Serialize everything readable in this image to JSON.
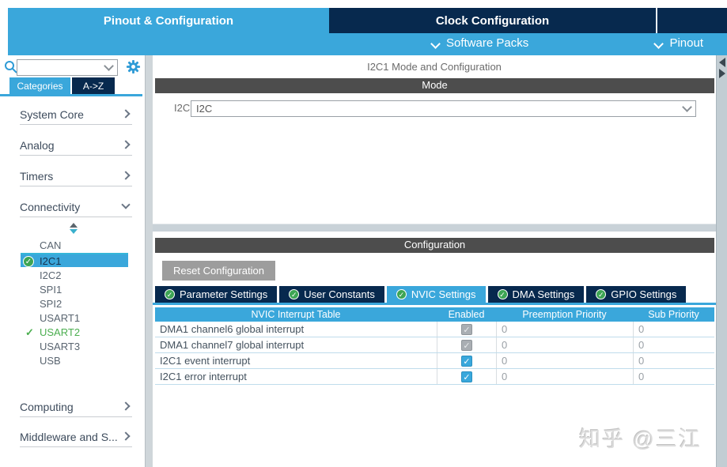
{
  "header": {
    "tabs": [
      {
        "label": "Pinout & Configuration",
        "active": true
      },
      {
        "label": "Clock Configuration",
        "active": false
      },
      {
        "label": "",
        "active": false
      }
    ],
    "subnav": [
      {
        "label": "Software Packs"
      },
      {
        "label": "Pinout"
      }
    ]
  },
  "sidebar": {
    "search": {
      "value": "",
      "placeholder": ""
    },
    "tabs": [
      {
        "label": "Categories",
        "active": true
      },
      {
        "label": "A->Z",
        "active": false
      }
    ],
    "categories": [
      {
        "label": "System Core",
        "state": "collapsed"
      },
      {
        "label": "Analog",
        "state": "collapsed"
      },
      {
        "label": "Timers",
        "state": "collapsed"
      },
      {
        "label": "Connectivity",
        "state": "expanded"
      }
    ],
    "connectivity_items": [
      {
        "label": "CAN",
        "selected": false,
        "configured": false
      },
      {
        "label": "I2C1",
        "selected": true,
        "configured": true
      },
      {
        "label": "I2C2",
        "selected": false,
        "configured": false
      },
      {
        "label": "SPI1",
        "selected": false,
        "configured": false
      },
      {
        "label": "SPI2",
        "selected": false,
        "configured": false
      },
      {
        "label": "USART1",
        "selected": false,
        "configured": false
      },
      {
        "label": "USART2",
        "selected": false,
        "configured": true
      },
      {
        "label": "USART3",
        "selected": false,
        "configured": false
      },
      {
        "label": "USB",
        "selected": false,
        "configured": false
      }
    ],
    "categories_bottom": [
      {
        "label": "Computing",
        "state": "collapsed"
      },
      {
        "label": "Middleware and S...",
        "state": "collapsed"
      }
    ],
    "icons": {
      "check": "✓"
    }
  },
  "main": {
    "title": "I2C1 Mode and Configuration",
    "mode_section": {
      "header": "Mode",
      "field_label": "I2C",
      "field_value": "I2C"
    },
    "config_section": {
      "header": "Configuration",
      "reset_button": "Reset Configuration",
      "tabs": [
        {
          "label": "Parameter Settings",
          "active": false
        },
        {
          "label": "User Constants",
          "active": false
        },
        {
          "label": "NVIC Settings",
          "active": true
        },
        {
          "label": "DMA Settings",
          "active": false
        },
        {
          "label": "GPIO Settings",
          "active": false
        }
      ],
      "table": {
        "headers": [
          "NVIC Interrupt Table",
          "Enabled",
          "Preemption Priority",
          "Sub Priority"
        ],
        "rows": [
          {
            "name": "DMA1 channel6 global interrupt",
            "enabled": true,
            "enabled_state": "disabled",
            "preemption": "0",
            "sub": "0"
          },
          {
            "name": "DMA1 channel7 global interrupt",
            "enabled": true,
            "enabled_state": "disabled",
            "preemption": "0",
            "sub": "0"
          },
          {
            "name": "I2C1 event interrupt",
            "enabled": true,
            "enabled_state": "enabled",
            "preemption": "0",
            "sub": "0"
          },
          {
            "name": "I2C1 error interrupt",
            "enabled": true,
            "enabled_state": "enabled",
            "preemption": "0",
            "sub": "0"
          }
        ]
      }
    }
  },
  "watermark": "知乎 @三江",
  "colors": {
    "accent_blue": "#3AA7DB",
    "navy": "#07294E",
    "section_bar": "#4D4D4D",
    "green_check": "#3DA554",
    "button_gray": "#9D9D9D"
  }
}
